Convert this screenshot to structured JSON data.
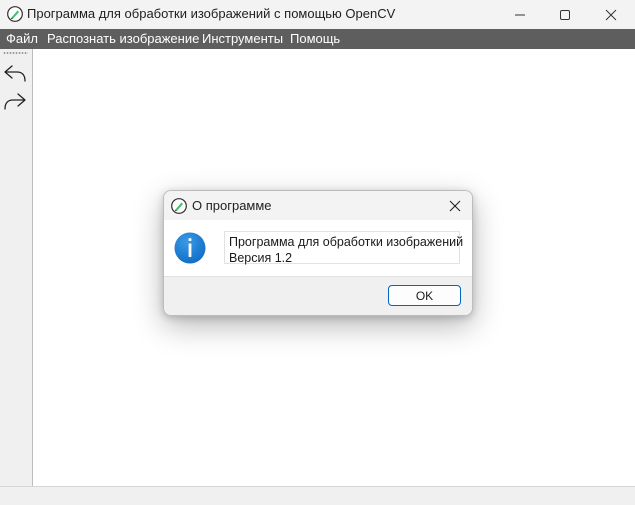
{
  "window": {
    "title": "Программа для обработки изображений с помощью OpenCV"
  },
  "menu": {
    "items": [
      {
        "label": "Файл"
      },
      {
        "label": "Распознать изображение"
      },
      {
        "label": "Инструменты"
      },
      {
        "label": "Помощь"
      }
    ]
  },
  "toolbar": {
    "buttons": [
      {
        "icon": "undo-arrow-icon"
      },
      {
        "icon": "redo-arrow-icon"
      }
    ]
  },
  "dialog": {
    "title": "О программе",
    "message_lines": [
      "Программа для обработки изображений",
      "Версия 1.2"
    ],
    "ok_label": "OK",
    "icon": "info-icon"
  },
  "colors": {
    "menubar_bg": "#5e5e5e",
    "titlebar_bg": "#f3f3f3",
    "accent": "#0067c0",
    "info_icon_blue": "#1e7fd1"
  }
}
